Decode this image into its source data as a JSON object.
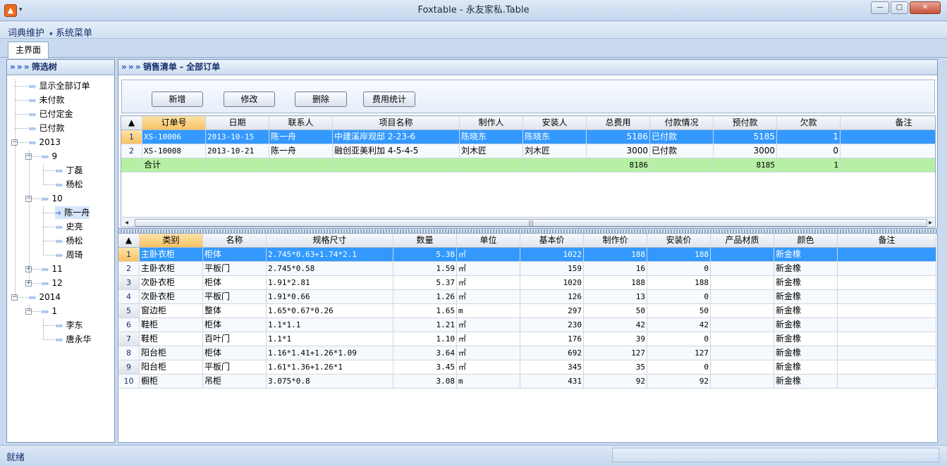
{
  "window": {
    "title": "Foxtable - 永友家私.Table",
    "app_icon_glyph": "▲",
    "quick_access_glyph": "▾",
    "minimize_glyph": "—",
    "maximize_glyph": "□",
    "close_glyph": "✕"
  },
  "menu": {
    "items": [
      {
        "label": "词典维护",
        "has_dropdown": true,
        "dropdown_glyph": "▾"
      },
      {
        "label": "系统菜单",
        "has_dropdown": false
      }
    ]
  },
  "tabs": [
    {
      "label": "主界面",
      "active": true
    }
  ],
  "filter_panel": {
    "title": "筛选树",
    "header_icon": "» » »",
    "node_icon": "»",
    "selected_icon": "➜",
    "expanded_glyph": "−",
    "collapsed_glyph": "+",
    "nodes": [
      {
        "label": "显示全部订单",
        "level": 0
      },
      {
        "label": "未付款",
        "level": 0
      },
      {
        "label": "已付定金",
        "level": 0
      },
      {
        "label": "已付款",
        "level": 0
      },
      {
        "label": "2013",
        "level": 0,
        "expander": "expanded"
      },
      {
        "label": "9",
        "level": 1,
        "expander": "expanded"
      },
      {
        "label": "丁磊",
        "level": 2
      },
      {
        "label": "杨松",
        "level": 2
      },
      {
        "label": "10",
        "level": 1,
        "expander": "expanded"
      },
      {
        "label": "陈一舟",
        "level": 2,
        "selected": true
      },
      {
        "label": "史亮",
        "level": 2
      },
      {
        "label": "杨松",
        "level": 2
      },
      {
        "label": "周琦",
        "level": 2
      },
      {
        "label": "11",
        "level": 1,
        "expander": "collapsed"
      },
      {
        "label": "12",
        "level": 1,
        "expander": "collapsed"
      },
      {
        "label": "2014",
        "level": 0,
        "expander": "expanded"
      },
      {
        "label": "1",
        "level": 1,
        "expander": "expanded"
      },
      {
        "label": "李东",
        "level": 2
      },
      {
        "label": "唐永华",
        "level": 2
      }
    ]
  },
  "orders_panel": {
    "title": "销售清单 - 全部订单",
    "header_icon": "» » »",
    "buttons": [
      "新增",
      "修改",
      "删除",
      "费用统计"
    ],
    "columns": [
      "订单号",
      "日期",
      "联系人",
      "项目名称",
      "制作人",
      "安装人",
      "总费用",
      "付款情况",
      "预付款",
      "欠款",
      "备注"
    ],
    "rows": [
      {
        "num": "1",
        "cells": [
          "XS-10006",
          "2013-10-15",
          "陈一舟",
          "中建溪岸观邸 2-23-6",
          "陈晓东",
          "陈晓东",
          "5186",
          "已付款",
          "5185",
          "1",
          ""
        ]
      },
      {
        "num": "2",
        "cells": [
          "XS-10008",
          "2013-10-21",
          "陈一舟",
          "融创亚美利加 4-5-4-5",
          "刘木匠",
          "刘木匠",
          "3000",
          "已付款",
          "3000",
          "0",
          ""
        ]
      }
    ],
    "total_row": {
      "label": "合计",
      "cells": [
        "",
        "",
        "",
        "",
        "",
        "8186",
        "",
        "8185",
        "1",
        ""
      ]
    },
    "sort_glyph": "▲",
    "scroll_left": "◂",
    "scroll_right": "▸",
    "scroll_thumb_grip": "|||"
  },
  "details_panel": {
    "columns": [
      "类别",
      "名称",
      "规格尺寸",
      "数量",
      "单位",
      "基本价",
      "制作价",
      "安装价",
      "产品材质",
      "颜色",
      "备注"
    ],
    "rows": [
      {
        "num": "1",
        "cells": [
          "主卧衣柜",
          "柜体",
          "2.745*0.63+1.74*2.1",
          "5.38",
          "㎡",
          "1022",
          "188",
          "188",
          "",
          "新金橡",
          ""
        ]
      },
      {
        "num": "2",
        "cells": [
          "主卧衣柜",
          "平板门",
          "2.745*0.58",
          "1.59",
          "㎡",
          "159",
          "16",
          "0",
          "",
          "新金橡",
          ""
        ]
      },
      {
        "num": "3",
        "cells": [
          "次卧衣柜",
          "柜体",
          "1.91*2.81",
          "5.37",
          "㎡",
          "1020",
          "188",
          "188",
          "",
          "新金橡",
          ""
        ]
      },
      {
        "num": "4",
        "cells": [
          "次卧衣柜",
          "平板门",
          "1.91*0.66",
          "1.26",
          "㎡",
          "126",
          "13",
          "0",
          "",
          "新金橡",
          ""
        ]
      },
      {
        "num": "5",
        "cells": [
          "窗边柜",
          "整体",
          "1.65*0.67*0.26",
          "1.65",
          "m",
          "297",
          "50",
          "50",
          "",
          "新金橡",
          ""
        ]
      },
      {
        "num": "6",
        "cells": [
          "鞋柜",
          "柜体",
          "1.1*1.1",
          "1.21",
          "㎡",
          "230",
          "42",
          "42",
          "",
          "新金橡",
          ""
        ]
      },
      {
        "num": "7",
        "cells": [
          "鞋柜",
          "百叶门",
          "1.1*1",
          "1.10",
          "㎡",
          "176",
          "39",
          "0",
          "",
          "新金橡",
          ""
        ]
      },
      {
        "num": "8",
        "cells": [
          "阳台柜",
          "柜体",
          "1.16*1.41+1.26*1.09",
          "3.64",
          "㎡",
          "692",
          "127",
          "127",
          "",
          "新金橡",
          ""
        ]
      },
      {
        "num": "9",
        "cells": [
          "阳台柜",
          "平板门",
          "1.61*1.36+1.26*1",
          "3.45",
          "㎡",
          "345",
          "35",
          "0",
          "",
          "新金橡",
          ""
        ]
      },
      {
        "num": "10",
        "cells": [
          "橱柜",
          "吊柜",
          "3.075*0.8",
          "3.08",
          "m",
          "431",
          "92",
          "92",
          "",
          "新金橡",
          ""
        ]
      }
    ],
    "sort_glyph": "▲"
  },
  "status": {
    "text": "就绪"
  }
}
